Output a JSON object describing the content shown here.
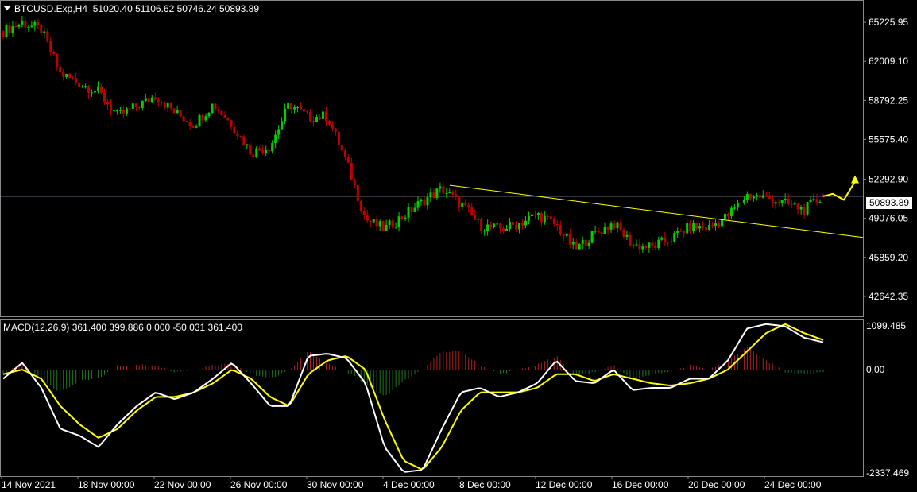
{
  "header": {
    "symbol": "BTCUSD.Exp,H4",
    "ohlc": "51020.40 51106.62 50746.24 50893.89"
  },
  "macd_header": {
    "label": "MACD(12,26,9)",
    "values": "361.400 399.886 0.000 -50.031 361.400"
  },
  "current_price_tag": "50893.89",
  "colors": {
    "background": "#000000",
    "bull": "#00d000",
    "bear": "#c00000",
    "hist_pos": "#b02020",
    "hist_neg": "#1e7a1e",
    "macd_line": "#ffffff",
    "signal_line": "#ffff00",
    "trendline": "#ffff00",
    "price_line": "#7f8fa0"
  },
  "chart_data": [
    {
      "type": "candlestick",
      "title": "BTCUSD.Exp,H4",
      "timeframe": "H4",
      "ylim": [
        41000,
        67000
      ],
      "y_ticks": [
        "65225.95",
        "62009.10",
        "58792.25",
        "55575.40",
        "52292.90",
        "49076.05",
        "45859.20",
        "42642.35"
      ],
      "x_ticks": [
        "14 Nov 2021",
        "18 Nov 00:00",
        "22 Nov 00:00",
        "26 Nov 00:00",
        "30 Nov 00:00",
        "4 Dec 00:00",
        "8 Dec 00:00",
        "12 Dec 00:00",
        "16 Dec 00:00",
        "20 Dec 00:00",
        "24 Dec 00:00"
      ],
      "close_path": [
        64500,
        65200,
        64600,
        61000,
        60200,
        59500,
        57500,
        58300,
        59200,
        57800,
        56800,
        58500,
        56800,
        54500,
        55000,
        58500,
        57400,
        57500,
        53700,
        49000,
        48200,
        49300,
        50500,
        51500,
        50300,
        48500,
        48200,
        48600,
        49400,
        48500,
        46500,
        47800,
        48700,
        46900,
        46700,
        47400,
        48400,
        48300,
        49300,
        51000,
        50800,
        50300,
        49800,
        50893.89
      ],
      "last": {
        "open": 51020.4,
        "high": 51106.62,
        "low": 50746.24,
        "close": 50893.89
      },
      "trendline": {
        "from": {
          "x": "6 Dec 00:00",
          "y": 51800
        },
        "to": {
          "x": "25 Dec 20:00",
          "y": 47500
        }
      },
      "projection_arrow": {
        "points": [
          50893.89,
          51100,
          50600,
          52100
        ]
      }
    },
    {
      "type": "macd",
      "title": "MACD(12,26,9)",
      "ylim": [
        -2337.469,
        1099.485
      ],
      "y_ticks": [
        "1099.485",
        "0.00",
        "-2337.469"
      ],
      "macd_path": [
        -200,
        150,
        -400,
        -1300,
        -1450,
        -1700,
        -1200,
        -800,
        -500,
        -650,
        -500,
        -200,
        150,
        -300,
        -800,
        -800,
        300,
        350,
        250,
        -300,
        -1700,
        -2250,
        -2200,
        -1300,
        -500,
        -400,
        -600,
        -500,
        -300,
        200,
        -250,
        -300,
        0,
        -450,
        -400,
        -400,
        -200,
        -200,
        200,
        900,
        1000,
        950,
        700,
        600
      ],
      "signal_path": [
        -100,
        0,
        -200,
        -800,
        -1200,
        -1500,
        -1300,
        -900,
        -600,
        -600,
        -500,
        -300,
        0,
        -200,
        -600,
        -800,
        -100,
        200,
        300,
        0,
        -1100,
        -2000,
        -2200,
        -1700,
        -900,
        -500,
        -500,
        -500,
        -400,
        -100,
        -100,
        -250,
        -100,
        -200,
        -300,
        -350,
        -300,
        -200,
        0,
        400,
        800,
        1000,
        800,
        650
      ],
      "histogram_path": [
        -100,
        150,
        -200,
        -500,
        -250,
        -200,
        100,
        100,
        100,
        -50,
        0,
        100,
        150,
        -100,
        -200,
        0,
        400,
        150,
        -50,
        -300,
        -600,
        -250,
        0,
        400,
        400,
        100,
        -100,
        0,
        100,
        300,
        -150,
        -50,
        100,
        -250,
        -100,
        -50,
        100,
        0,
        200,
        500,
        200,
        -50,
        -100,
        -50
      ]
    }
  ]
}
